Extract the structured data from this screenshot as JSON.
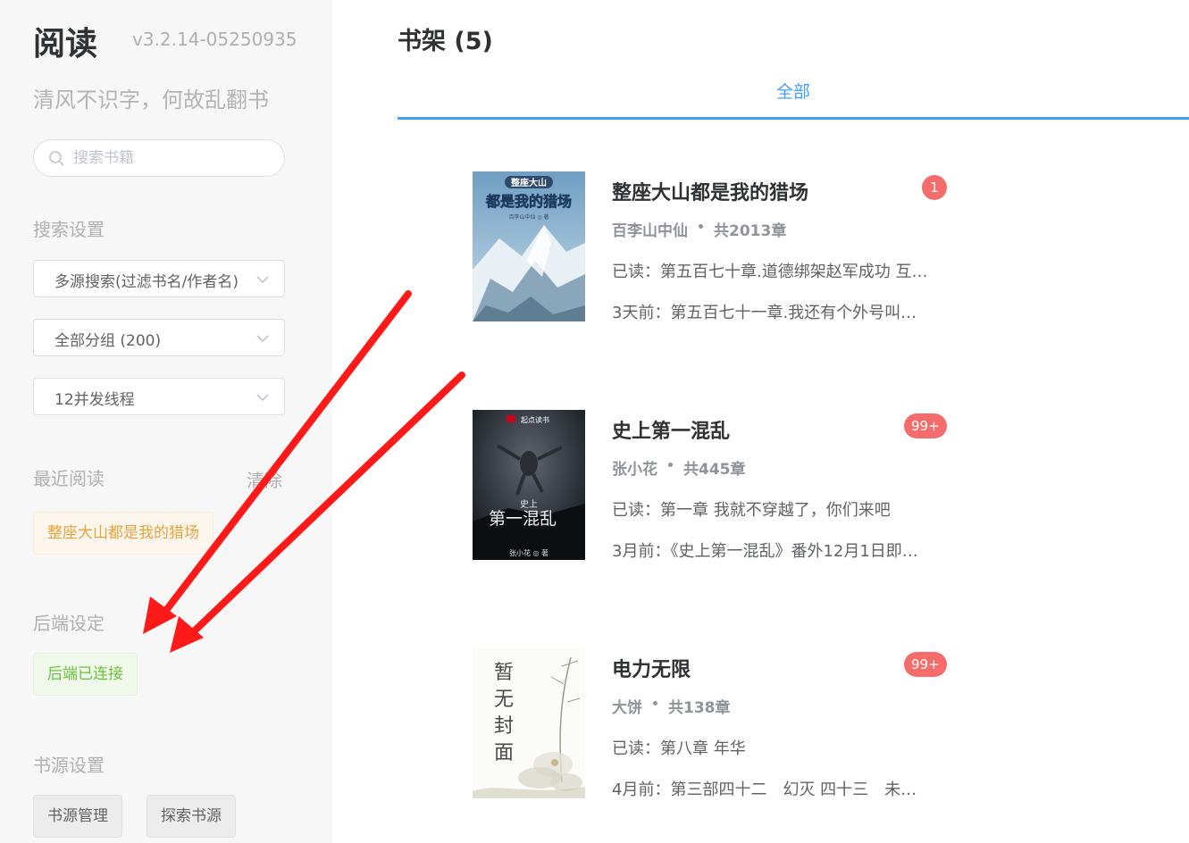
{
  "sidebar": {
    "app_title": "阅读",
    "version": "v3.2.14-05250935",
    "slogan": "清风不识字，何故乱翻书",
    "search_placeholder": "搜索书籍",
    "search_settings_label": "搜索设置",
    "source_mode": "多源搜索(过滤书名/作者名)",
    "group": "全部分组 (200)",
    "threads": "12并发线程",
    "recent_label": "最近阅读",
    "clear_label": "清除",
    "recent_book": "整座大山都是我的猎场",
    "backend_label": "后端设定",
    "backend_status": "后端已连接",
    "source_settings_label": "书源设置",
    "source_manage": "书源管理",
    "source_explore": "探索书源"
  },
  "main": {
    "shelf_title": "书架 (5)",
    "tab_all": "全部"
  },
  "books": [
    {
      "title": "整座大山都是我的猎场",
      "author": "百李山中仙",
      "chapters": "共2013章",
      "read": "已读：第五百七十章.道德绑架赵军成功 互…",
      "latest": "3天前：第五百七十一章.我还有个外号叫…",
      "badge": "1",
      "cover": {
        "line1": "整座大山",
        "line2": "都是我的猎场",
        "author": "百李山中仙 ◎ 著"
      }
    },
    {
      "title": "史上第一混乱",
      "author": "张小花",
      "chapters": "共445章",
      "read": "已读：第一章 我就不穿越了，你们来吧",
      "latest": "3月前：《史上第一混乱》番外12月1日即…",
      "badge": "99+",
      "cover": {
        "brand": "起点读书",
        "line1": "史上",
        "line2": "第一混乱",
        "author": "张小花 ◎ 著"
      }
    },
    {
      "title": "电力无限",
      "author": "大饼",
      "chapters": "共138章",
      "read": "已读：第八章 年华",
      "latest": "4月前：第三部四十二　幻灭 四十三　未…",
      "badge": "99+",
      "cover": {
        "text": "暂无封面"
      }
    }
  ],
  "colors": {
    "accent": "#409eff",
    "badge": "#f56c6c",
    "arrow": "#ff1a1a",
    "warning_tag": "#e6a23c",
    "success_tag": "#67c23a"
  }
}
